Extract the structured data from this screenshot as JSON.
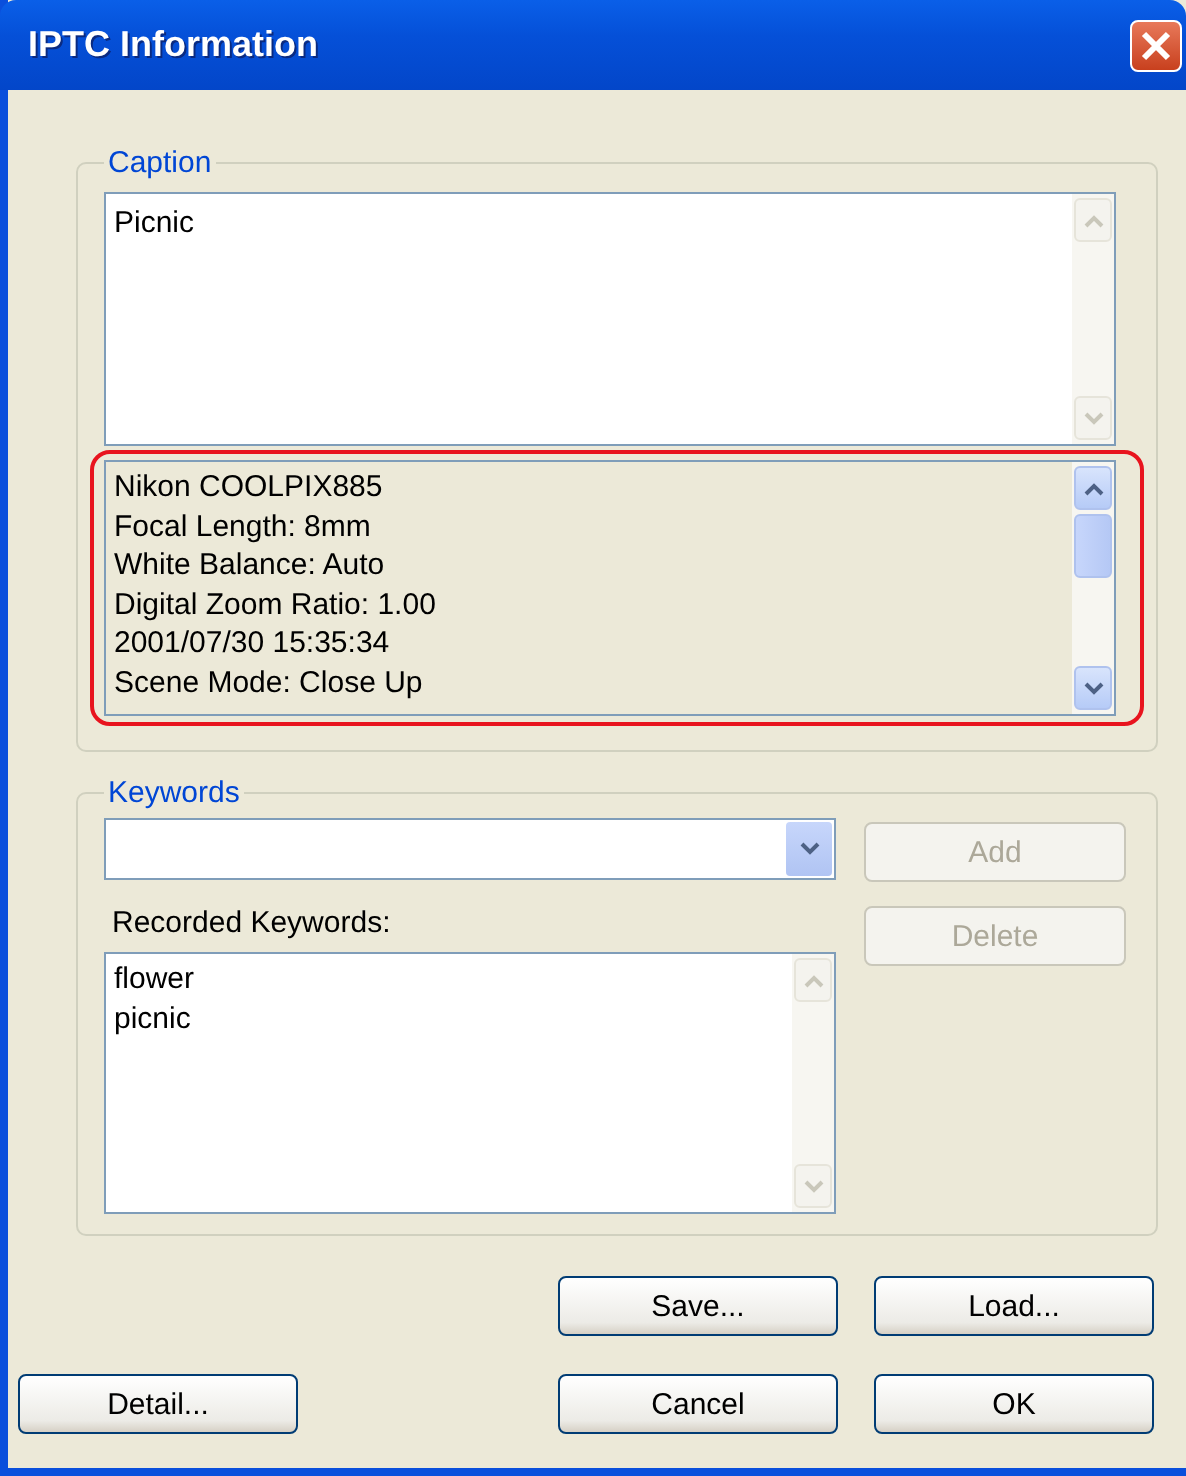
{
  "window": {
    "title": "IPTC Information"
  },
  "caption": {
    "label": "Caption",
    "value": "Picnic",
    "info_lines": [
      "Nikon COOLPIX885",
      "Focal Length: 8mm",
      "White Balance: Auto",
      "Digital Zoom Ratio: 1.00",
      "2001/07/30 15:35:34",
      "Scene Mode: Close Up"
    ],
    "highlighted": true
  },
  "keywords": {
    "label": "Keywords",
    "add_button": {
      "label": "Add",
      "disabled": true
    },
    "delete_button": {
      "label": "Delete",
      "disabled": true
    },
    "recorded_label": "Recorded Keywords:",
    "recorded": [
      "flower",
      "picnic"
    ]
  },
  "buttons": [
    {
      "label": "Save...",
      "kind": "save"
    },
    {
      "label": "Load...",
      "kind": "load"
    },
    {
      "label": "Detail...",
      "kind": "detail"
    },
    {
      "label": "Cancel",
      "kind": "cancel"
    },
    {
      "label": "OK",
      "kind": "ok"
    }
  ]
}
